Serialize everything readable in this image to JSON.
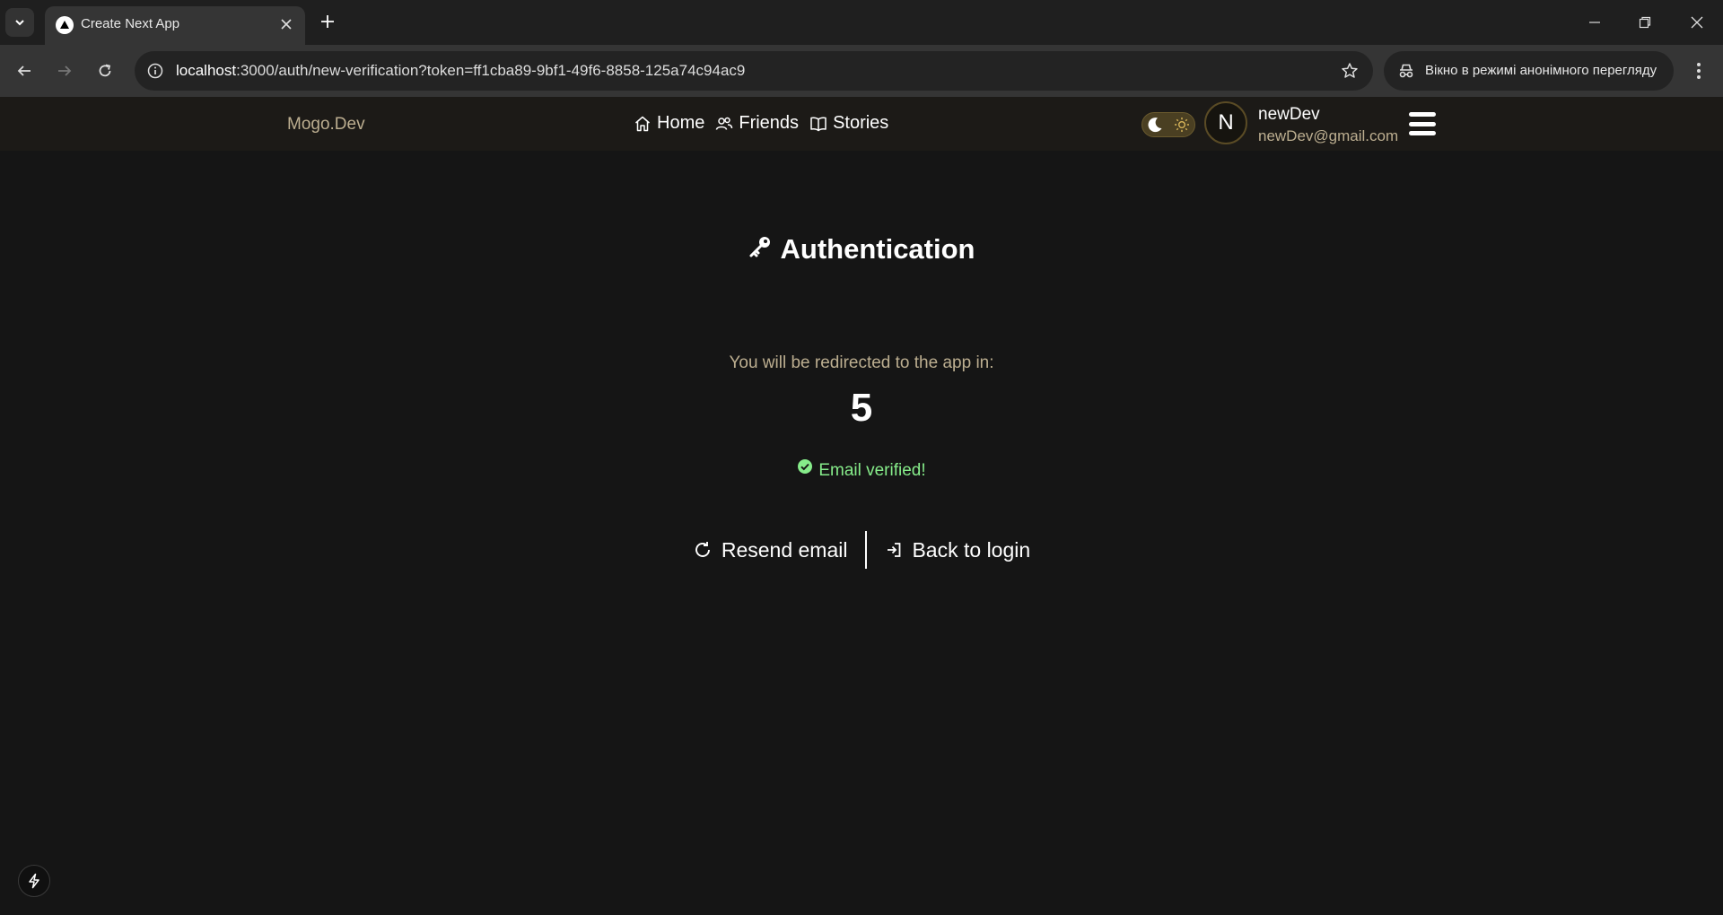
{
  "browser": {
    "tab_title": "Create Next App",
    "url_host": "localhost",
    "url_rest": ":3000/auth/new-verification?token=ff1cba89-9bf1-49f6-8858-125a74c94ac9",
    "incognito_label": "Вікно в режимі анонімного перегляду"
  },
  "header": {
    "brand": "Mogo.Dev",
    "nav": [
      {
        "label": "Home",
        "icon": "home-icon"
      },
      {
        "label": "Friends",
        "icon": "users-icon"
      },
      {
        "label": "Stories",
        "icon": "book-icon"
      }
    ],
    "user": {
      "initial": "N",
      "name": "newDev",
      "email": "newDev@gmail.com"
    }
  },
  "auth": {
    "title": "Authentication",
    "redirect_text": "You will be redirected to the app in:",
    "countdown": "5",
    "success_message": "Email verified!",
    "resend_label": "Resend email",
    "back_label": "Back to login"
  },
  "colors": {
    "background": "#151515",
    "header_bg": "#1c1a17",
    "muted_accent": "#bcae90",
    "success": "#86ec8a"
  }
}
